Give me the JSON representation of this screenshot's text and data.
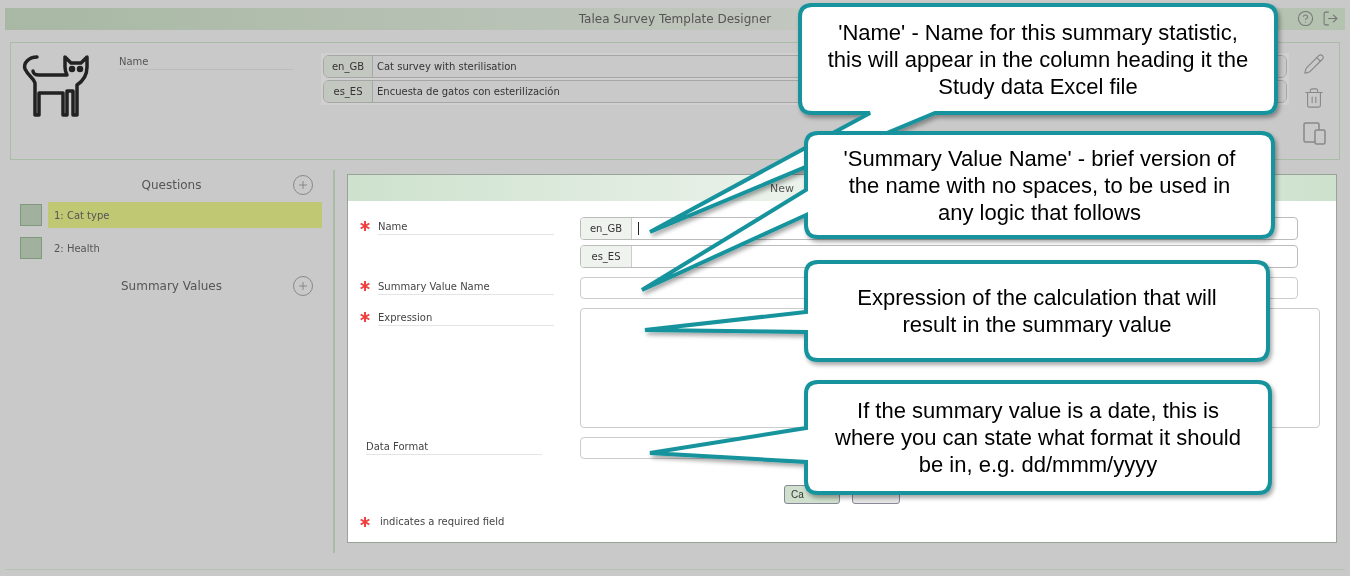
{
  "window": {
    "title": "Talea Survey Template Designer"
  },
  "survey": {
    "name_label": "Name",
    "names": [
      {
        "lang": "en_GB",
        "value": "Cat survey with sterilisation"
      },
      {
        "lang": "es_ES",
        "value": "Encuesta de gatos con esterilización"
      }
    ]
  },
  "sidebar": {
    "sections": [
      {
        "title": "Questions",
        "items": [
          {
            "label": "1: Cat type",
            "selected": true
          },
          {
            "label": "2: Health",
            "selected": false
          }
        ]
      },
      {
        "title": "Summary Values"
      }
    ]
  },
  "dialog": {
    "title": "New",
    "fields": [
      {
        "label": "Name",
        "required": true,
        "kind": "multilang",
        "langs": [
          {
            "code": "en_GB",
            "focused": true
          },
          {
            "code": "es_ES",
            "focused": false
          }
        ]
      },
      {
        "label": "Summary Value Name",
        "required": true,
        "kind": "text"
      },
      {
        "label": "Expression",
        "required": true,
        "kind": "textarea"
      },
      {
        "label": "Data Format",
        "required": false,
        "kind": "text"
      }
    ],
    "buttons": [
      {
        "label": "Ca",
        "kind": "primary"
      },
      {
        "kind": "secondary"
      }
    ],
    "legend": "indicates a required field"
  },
  "callouts": [
    {
      "text": "'Name' - Name for this summary statistic, this will appear in the column heading it the Study data Excel file"
    },
    {
      "text": "'Summary Value Name' - brief version of the name with no spaces, to be used in any logic that follows"
    },
    {
      "text": "Expression of the calculation that will result in the summary value"
    },
    {
      "text": "If the summary value is a date, this is where you can state what format it should be in, e.g. dd/mmm/yyyy"
    }
  ]
}
